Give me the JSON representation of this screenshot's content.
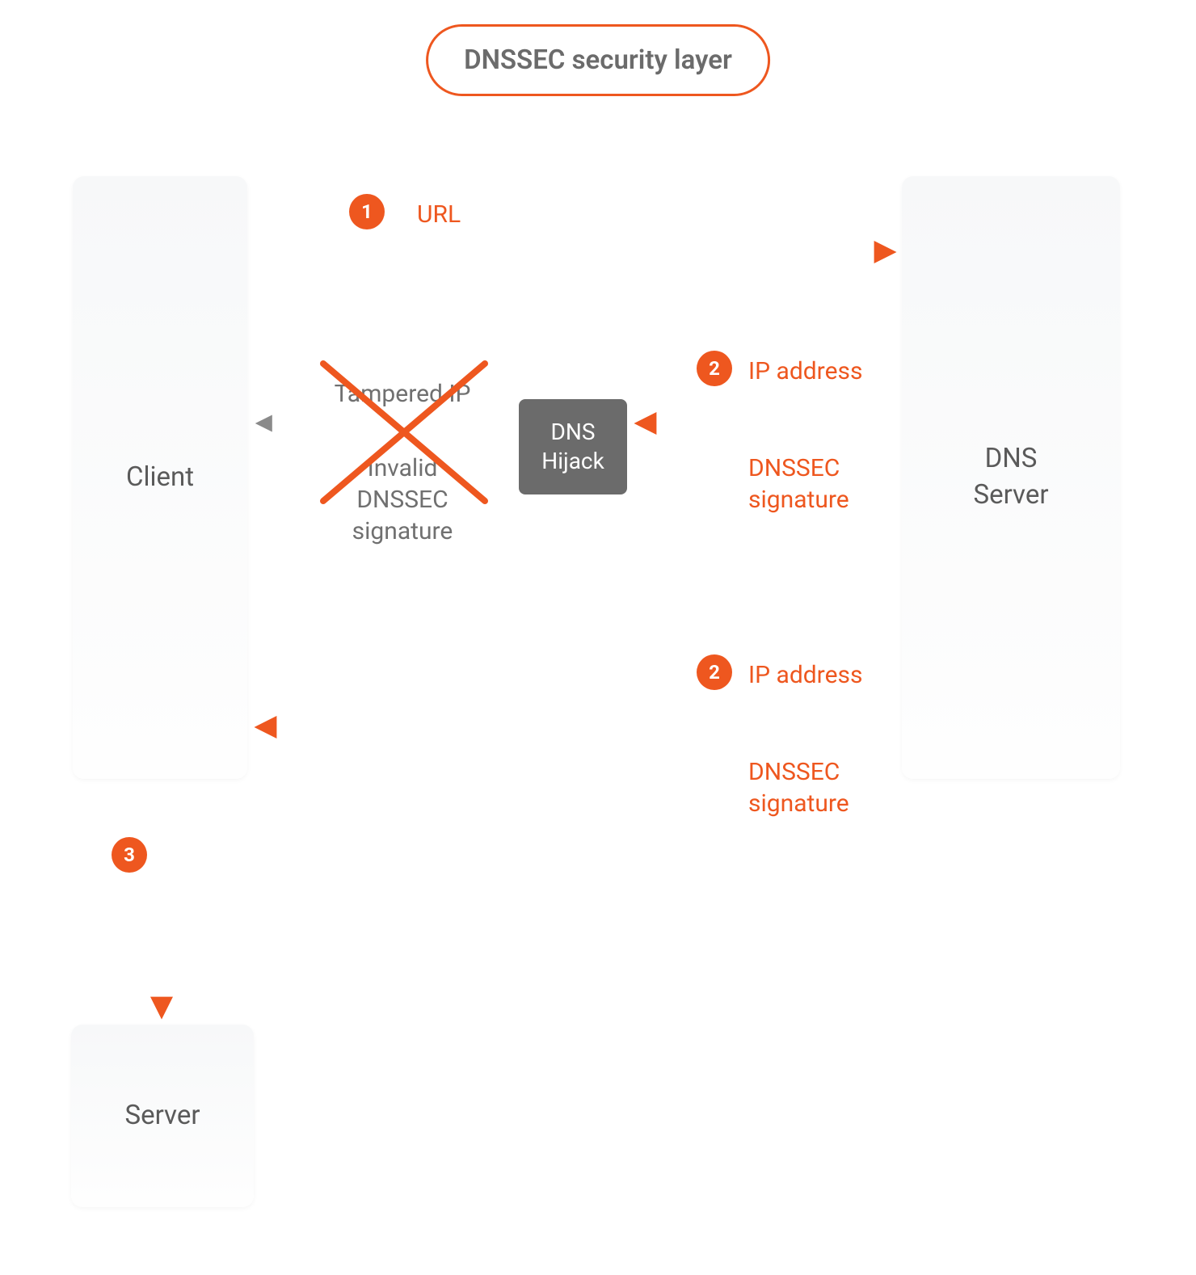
{
  "title": "DNSSEC security layer",
  "colors": {
    "accent": "#ee571f",
    "grey": "#6b6b6b"
  },
  "nodes": {
    "client": "Client",
    "dns_server": "DNS\nServer",
    "server": "Server",
    "hijack": "DNS\nHijack"
  },
  "steps": {
    "s1": "1",
    "s2": "2",
    "s3": "3"
  },
  "labels": {
    "url": "URL",
    "ip_address": "IP address",
    "dnssec_signature": "DNSSEC\nsignature",
    "tampered_ip": "Tampered IP",
    "invalid_dnssec_signature": "Invalid\nDNSSEC\nsignature"
  }
}
